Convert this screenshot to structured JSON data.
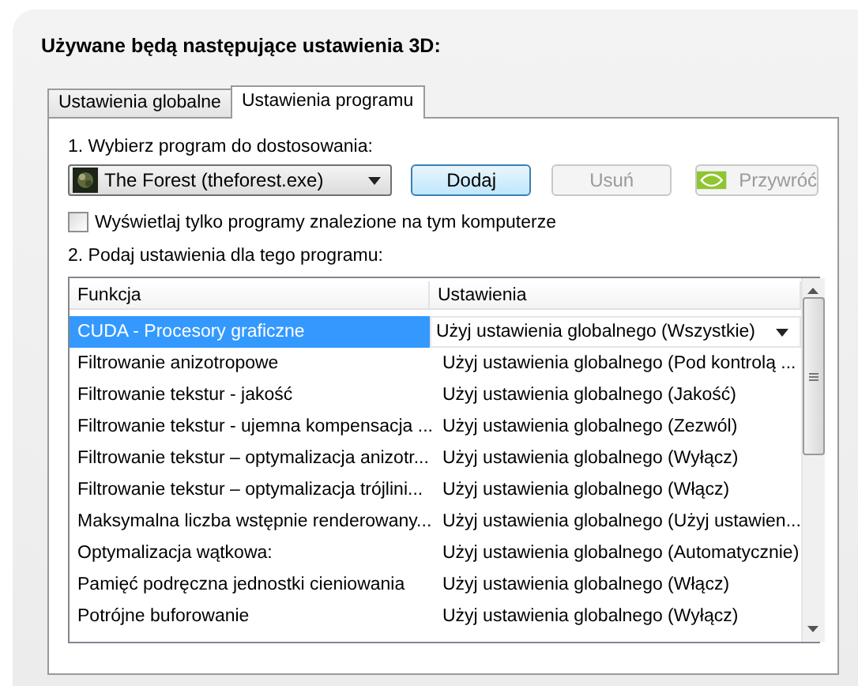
{
  "heading": "Używane będą następujące ustawienia 3D:",
  "tabs": [
    {
      "label": "Ustawienia globalne",
      "selected": false
    },
    {
      "label": "Ustawienia programu",
      "selected": true
    }
  ],
  "program_label": "1. Wybierz program do dostosowania:",
  "program_select": {
    "value": "The Forest (theforest.exe)"
  },
  "buttons": [
    {
      "label": "Dodaj",
      "disabled": false,
      "kind": "plain"
    },
    {
      "label": "Usuń",
      "disabled": true,
      "kind": "plain"
    },
    {
      "label": "Przywróć",
      "disabled": true,
      "kind": "logo"
    }
  ],
  "filter_checkbox": {
    "label": "Wyświetlaj tylko programy znalezione na tym komputerze",
    "checked": false
  },
  "settings_label": "2. Podaj ustawienia dla tego programu:",
  "table": {
    "columns": [
      "Funkcja",
      "Ustawienia"
    ],
    "rows": [
      {
        "function": "CUDA - Procesory graficzne",
        "setting": "Użyj ustawienia globalnego (Wszystkie)",
        "selected": true
      },
      {
        "function": "Filtrowanie anizotropowe",
        "setting": "Użyj ustawienia globalnego (Pod kontrolą ...",
        "selected": false
      },
      {
        "function": "Filtrowanie tekstur - jakość",
        "setting": "Użyj ustawienia globalnego (Jakość)",
        "selected": false
      },
      {
        "function": "Filtrowanie tekstur - ujemna kompensacja ...",
        "setting": "Użyj ustawienia globalnego (Zezwól)",
        "selected": false
      },
      {
        "function": "Filtrowanie tekstur – optymalizacja anizotr...",
        "setting": "Użyj ustawienia globalnego (Wyłącz)",
        "selected": false
      },
      {
        "function": "Filtrowanie tekstur – optymalizacja trójlini...",
        "setting": "Użyj ustawienia globalnego (Włącz)",
        "selected": false
      },
      {
        "function": "Maksymalna liczba wstępnie renderowany...",
        "setting": "Użyj ustawienia globalnego (Użyj ustawien...",
        "selected": false
      },
      {
        "function": "Optymalizacja wątkowa:",
        "setting": "Użyj ustawienia globalnego (Automatycznie)",
        "selected": false
      },
      {
        "function": "Pamięć podręczna jednostki cieniowania",
        "setting": "Użyj ustawienia globalnego (Włącz)",
        "selected": false
      },
      {
        "function": "Potrójne buforowanie",
        "setting": "Użyj ustawienia globalnego (Wyłącz)",
        "selected": false
      }
    ]
  }
}
